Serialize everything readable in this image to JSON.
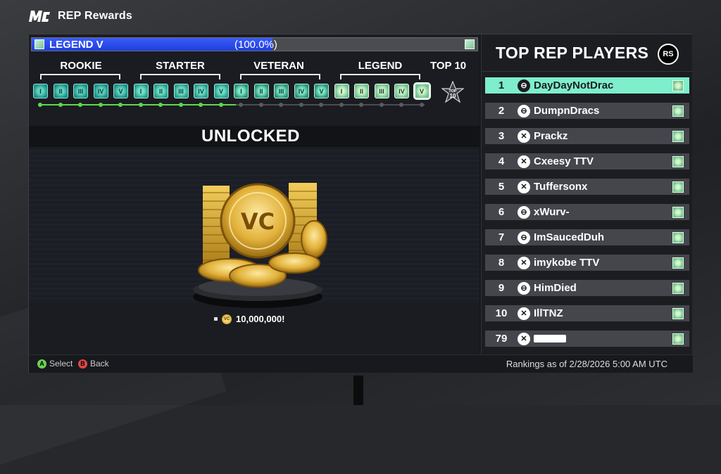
{
  "header": {
    "logo": "MC",
    "title": "REP Rewards"
  },
  "progress": {
    "tier_label": "LEGEND V",
    "percent_text": "(100.0%)",
    "fraction": 1.0
  },
  "tiers": [
    {
      "label": "ROOKIE"
    },
    {
      "label": "STARTER"
    },
    {
      "label": "VETERAN"
    },
    {
      "label": "LEGEND"
    },
    {
      "label": "TOP 10"
    }
  ],
  "badge_glyphs": [
    "I",
    "II",
    "III",
    "IV",
    "V",
    "I",
    "II",
    "III",
    "IV",
    "V",
    "I",
    "II",
    "III",
    "IV",
    "V",
    "I",
    "II",
    "III",
    "IV",
    "V"
  ],
  "top10_badge": {
    "line1": "TOP",
    "line2": "10"
  },
  "unlocked": {
    "title": "UNLOCKED",
    "reward_text": "10,000,000!",
    "coin_label": "VC"
  },
  "leaderboard": {
    "title": "TOP REP PLAYERS",
    "rs_button": "RS",
    "rows": [
      {
        "rank": "1",
        "name": "DayDayNotDrac",
        "platform": "ps"
      },
      {
        "rank": "2",
        "name": "DumpnDracs",
        "platform": "ps"
      },
      {
        "rank": "3",
        "name": "Prackz",
        "platform": "xbox"
      },
      {
        "rank": "4",
        "name": "Cxeesy TTV",
        "platform": "xbox"
      },
      {
        "rank": "5",
        "name": "Tuffersonx",
        "platform": "xbox"
      },
      {
        "rank": "6",
        "name": "xWurv-",
        "platform": "ps"
      },
      {
        "rank": "7",
        "name": "ImSaucedDuh",
        "platform": "ps"
      },
      {
        "rank": "8",
        "name": "imykobe TTV",
        "platform": "xbox"
      },
      {
        "rank": "9",
        "name": "HimDied",
        "platform": "ps"
      },
      {
        "rank": "10",
        "name": "IllTNZ",
        "platform": "xbox"
      },
      {
        "rank": "79",
        "name": "",
        "platform": "xbox"
      }
    ]
  },
  "footer": {
    "select_key": "A",
    "select_label": "Select",
    "back_key": "B",
    "back_label": "Back",
    "rankings_text": "Rankings as of 2/28/2026 5:00 AM UTC"
  },
  "colors": {
    "accent_blue": "#2a4cf0",
    "accent_green": "#7eeecb",
    "progress_green": "#5ed84c"
  }
}
